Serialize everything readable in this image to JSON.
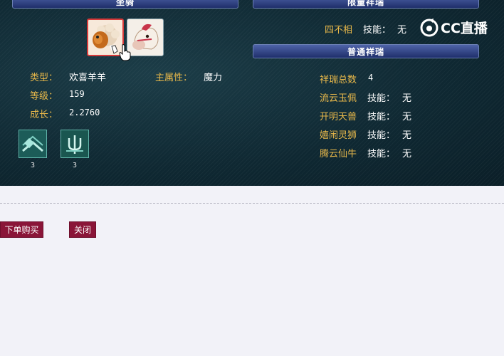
{
  "headers": {
    "left": "坐骑",
    "right": "限量祥瑞",
    "normal": "普通祥瑞"
  },
  "limited": {
    "name": "四不相",
    "skill_label": "技能：",
    "skill_value": "无"
  },
  "logo": {
    "text": "CC直播"
  },
  "pet": {
    "type_label": "类型：",
    "type_value": "欢喜羊羊",
    "attr_label": "主属性：",
    "attr_value": "魔力",
    "level_label": "等级：",
    "level_value": "159",
    "growth_label": "成长：",
    "growth_value": "2.2760"
  },
  "skills": [
    {
      "icon": "skill-rune-icon",
      "level": "3"
    },
    {
      "icon": "skill-trident-icon",
      "level": "3"
    }
  ],
  "normal": {
    "total_label": "祥瑞总数",
    "total_value": "4",
    "items": [
      {
        "name": "流云玉佩",
        "skill_label": "技能：",
        "skill_value": "无"
      },
      {
        "name": "开明天兽",
        "skill_label": "技能：",
        "skill_value": "无"
      },
      {
        "name": "嬉闹灵狮",
        "skill_label": "技能：",
        "skill_value": "无"
      },
      {
        "name": "腾云仙牛",
        "skill_label": "技能：",
        "skill_value": "无"
      }
    ]
  },
  "buttons": {
    "buy": "下单购买",
    "close": "关闭"
  },
  "colors": {
    "label": "#e8b84a",
    "panel": "#0f2a34",
    "button": "#8a1538",
    "page": "#f2f2f8"
  }
}
